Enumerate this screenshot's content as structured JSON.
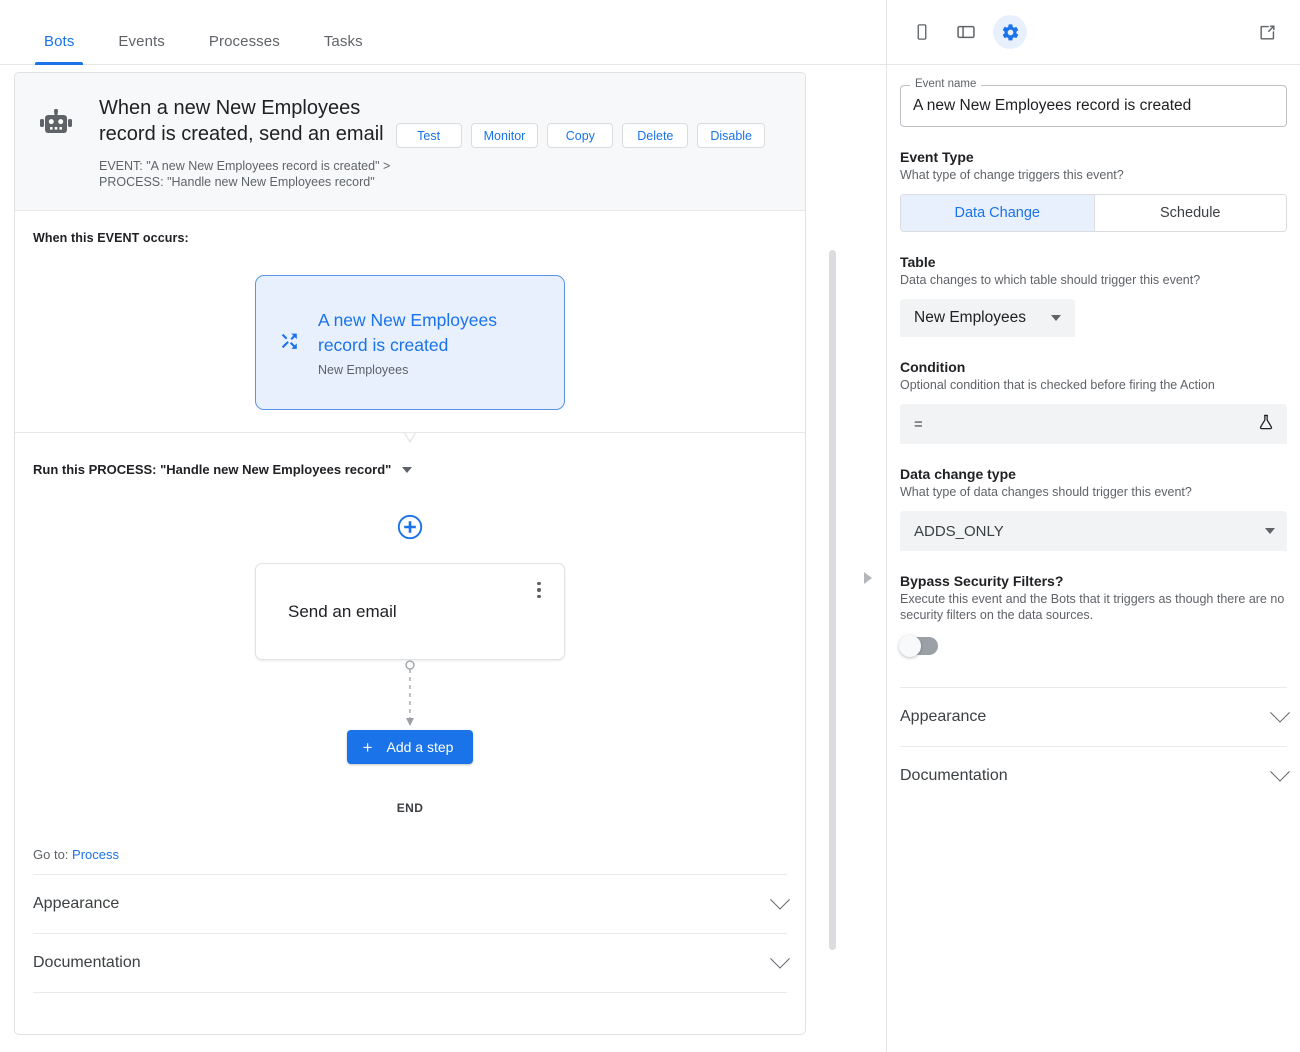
{
  "tabs": [
    {
      "label": "Bots",
      "active": true
    },
    {
      "label": "Events",
      "active": false
    },
    {
      "label": "Processes",
      "active": false
    },
    {
      "label": "Tasks",
      "active": false
    }
  ],
  "bot": {
    "icon": "robot-icon",
    "title": "When a new New Employees record is created, send an email",
    "subtitle_line1": "EVENT: \"A new New Employees record is created\" >",
    "subtitle_line2": "PROCESS: \"Handle new New Employees record\"",
    "actions": [
      {
        "label": "Test",
        "name": "test-button"
      },
      {
        "label": "Monitor",
        "name": "monitor-button"
      },
      {
        "label": "Copy",
        "name": "copy-button"
      },
      {
        "label": "Delete",
        "name": "delete-button"
      },
      {
        "label": "Disable",
        "name": "disable-button"
      }
    ]
  },
  "event_section": {
    "heading": "When this EVENT occurs:",
    "card": {
      "icon": "shuffle-icon",
      "title": "A new New Employees record is created",
      "table": "New Employees"
    }
  },
  "process_section": {
    "label": "Run this PROCESS: \"Handle new New Employees record\"",
    "add_above_icon": "plus-circle-icon",
    "step": {
      "label": "Send an email",
      "menu_icon": "kebab-menu-icon"
    },
    "add_step_label": "Add a step",
    "add_step_icon": "plus-icon",
    "end_label": "END"
  },
  "footer": {
    "goto_prefix": "Go to: ",
    "goto_link": "Process",
    "accordions": [
      {
        "label": "Appearance",
        "name": "appearance-section"
      },
      {
        "label": "Documentation",
        "name": "documentation-section"
      }
    ]
  },
  "right_panel": {
    "toolbar": {
      "icons": [
        {
          "name": "mobile-preview-icon",
          "active": false
        },
        {
          "name": "tablet-preview-icon",
          "active": false
        },
        {
          "name": "settings-gear-icon",
          "active": true
        }
      ],
      "open_external_icon": "open-in-new-icon"
    },
    "event_name": {
      "legend": "Event name",
      "value": "A new New Employees record is created"
    },
    "event_type": {
      "title": "Event Type",
      "help": "What type of change triggers this event?",
      "options": [
        {
          "label": "Data Change",
          "selected": true
        },
        {
          "label": "Schedule",
          "selected": false
        }
      ]
    },
    "table": {
      "title": "Table",
      "help": "Data changes to which table should trigger this event?",
      "value": "New Employees"
    },
    "condition": {
      "title": "Condition",
      "help": "Optional condition that is checked before firing the Action",
      "value": "=",
      "trailing_icon": "flask-icon"
    },
    "data_change_type": {
      "title": "Data change type",
      "help": "What type of data changes should trigger this event?",
      "value": "ADDS_ONLY"
    },
    "bypass": {
      "title": "Bypass Security Filters?",
      "help": "Execute this event and the Bots that it triggers as though there are no security filters on the data sources.",
      "enabled": false
    },
    "accordions": [
      {
        "label": "Appearance",
        "name": "appearance-section"
      },
      {
        "label": "Documentation",
        "name": "documentation-section"
      }
    ]
  },
  "colors": {
    "accent": "#1a73e8",
    "accent_bg": "#e8f0fe",
    "text": "#202124",
    "muted": "#5f6368",
    "border": "#dadce0"
  }
}
